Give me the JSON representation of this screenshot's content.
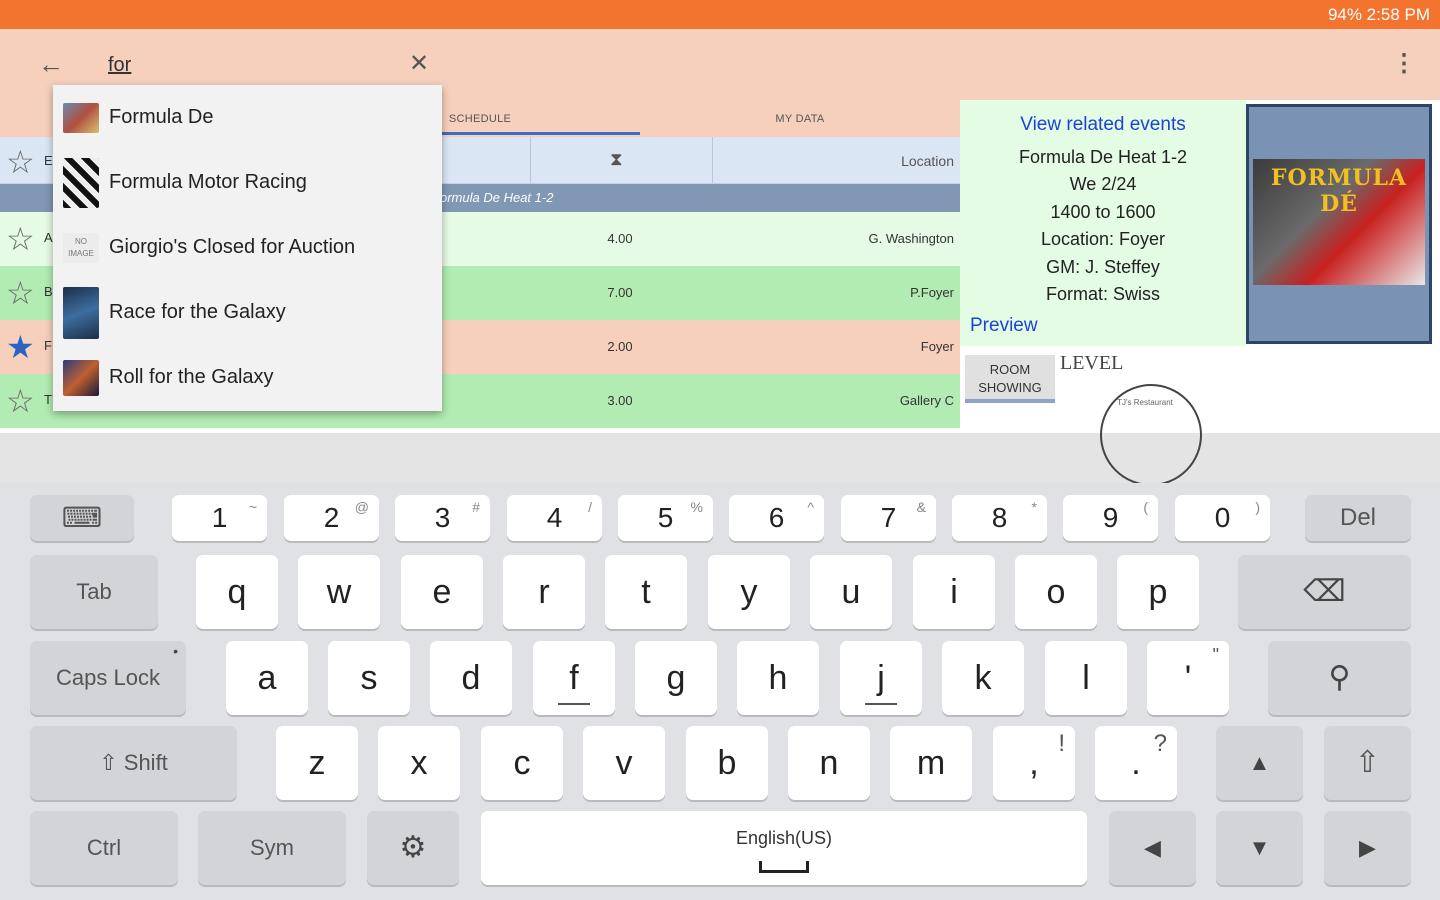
{
  "status_bar": {
    "text": "94%  2:58 PM"
  },
  "search": {
    "query": "for"
  },
  "icons": {
    "back": "←",
    "clear": "✕",
    "overflow": "⋮",
    "star_empty": "☆",
    "star_filled": "★",
    "hourglass": "⧗",
    "keyboard": "⌨",
    "backspace": "⌫",
    "search": "⚲",
    "shift": "⇧",
    "gear": "⚙",
    "up": "▲",
    "down": "▼",
    "left": "◀",
    "right": "▶",
    "caps_up": "⇧"
  },
  "tabs": {
    "schedule": "SCHEDULE",
    "my_data": "MY DATA"
  },
  "table": {
    "location_header": "Location",
    "group_title": "ormula De Heat 1-2",
    "rows": [
      {
        "initial": "A",
        "duration": "4.00",
        "location": "G. Washington",
        "starred": false,
        "color": "#e6fbe6"
      },
      {
        "initial": "B",
        "duration": "7.00",
        "location": "P.Foyer",
        "starred": false,
        "color": "#b2ecb2"
      },
      {
        "initial": "F",
        "duration": "2.00",
        "location": "Foyer",
        "starred": true,
        "color": "#f6d0bd"
      },
      {
        "initial": "T",
        "duration": "3.00",
        "location": "Gallery C",
        "starred": false,
        "color": "#b2ecb2"
      }
    ],
    "top_row_initial": "E"
  },
  "detail": {
    "related_link": "View related events",
    "lines": [
      "Formula De Heat 1-2",
      "We 2/24",
      "1400 to 1600",
      "Location: Foyer",
      "GM: J. Steffey",
      "Format: Swiss"
    ],
    "preview_link": "Preview",
    "box_art_title": "FORMULA DÉ",
    "room_button": "ROOM SHOWING",
    "level_label": "LEVEL",
    "map_text": "TJ's Restaurant"
  },
  "dropdown": [
    {
      "label": "Formula De",
      "thumb_color": "#8a5a48"
    },
    {
      "label": "Formula Motor Racing",
      "thumb_color": "#333333"
    },
    {
      "label": "Giorgio's Closed for Auction",
      "thumb_color": "#e8e8e8",
      "thumb_text": "NO IMAGE"
    },
    {
      "label": "Race for the Galaxy",
      "thumb_color": "#243a55"
    },
    {
      "label": "Roll for the Galaxy",
      "thumb_color": "#4a3c6e"
    }
  ],
  "keyboard": {
    "number_row": [
      {
        "main": "1",
        "sec": "~"
      },
      {
        "main": "2",
        "sec": "@"
      },
      {
        "main": "3",
        "sec": "#"
      },
      {
        "main": "4",
        "sec": "/"
      },
      {
        "main": "5",
        "sec": "%"
      },
      {
        "main": "6",
        "sec": "^"
      },
      {
        "main": "7",
        "sec": "&"
      },
      {
        "main": "8",
        "sec": "*"
      },
      {
        "main": "9",
        "sec": "("
      },
      {
        "main": "0",
        "sec": ")"
      }
    ],
    "del": "Del",
    "tab": "Tab",
    "row_q": [
      "q",
      "w",
      "e",
      "r",
      "t",
      "y",
      "u",
      "i",
      "o",
      "p"
    ],
    "caps": "Caps Lock",
    "row_a": [
      "a",
      "s",
      "d",
      "f",
      "g",
      "h",
      "j",
      "k",
      "l"
    ],
    "row_a_extra": {
      "main": "'",
      "sec": "\""
    },
    "shift": "Shift",
    "row_z": [
      "z",
      "x",
      "c",
      "v",
      "b",
      "n",
      "m"
    ],
    "comma": {
      "main": ",",
      "sec": "!"
    },
    "period": {
      "main": ".",
      "sec": "?"
    },
    "ctrl": "Ctrl",
    "sym": "Sym",
    "space": "English(US)"
  }
}
